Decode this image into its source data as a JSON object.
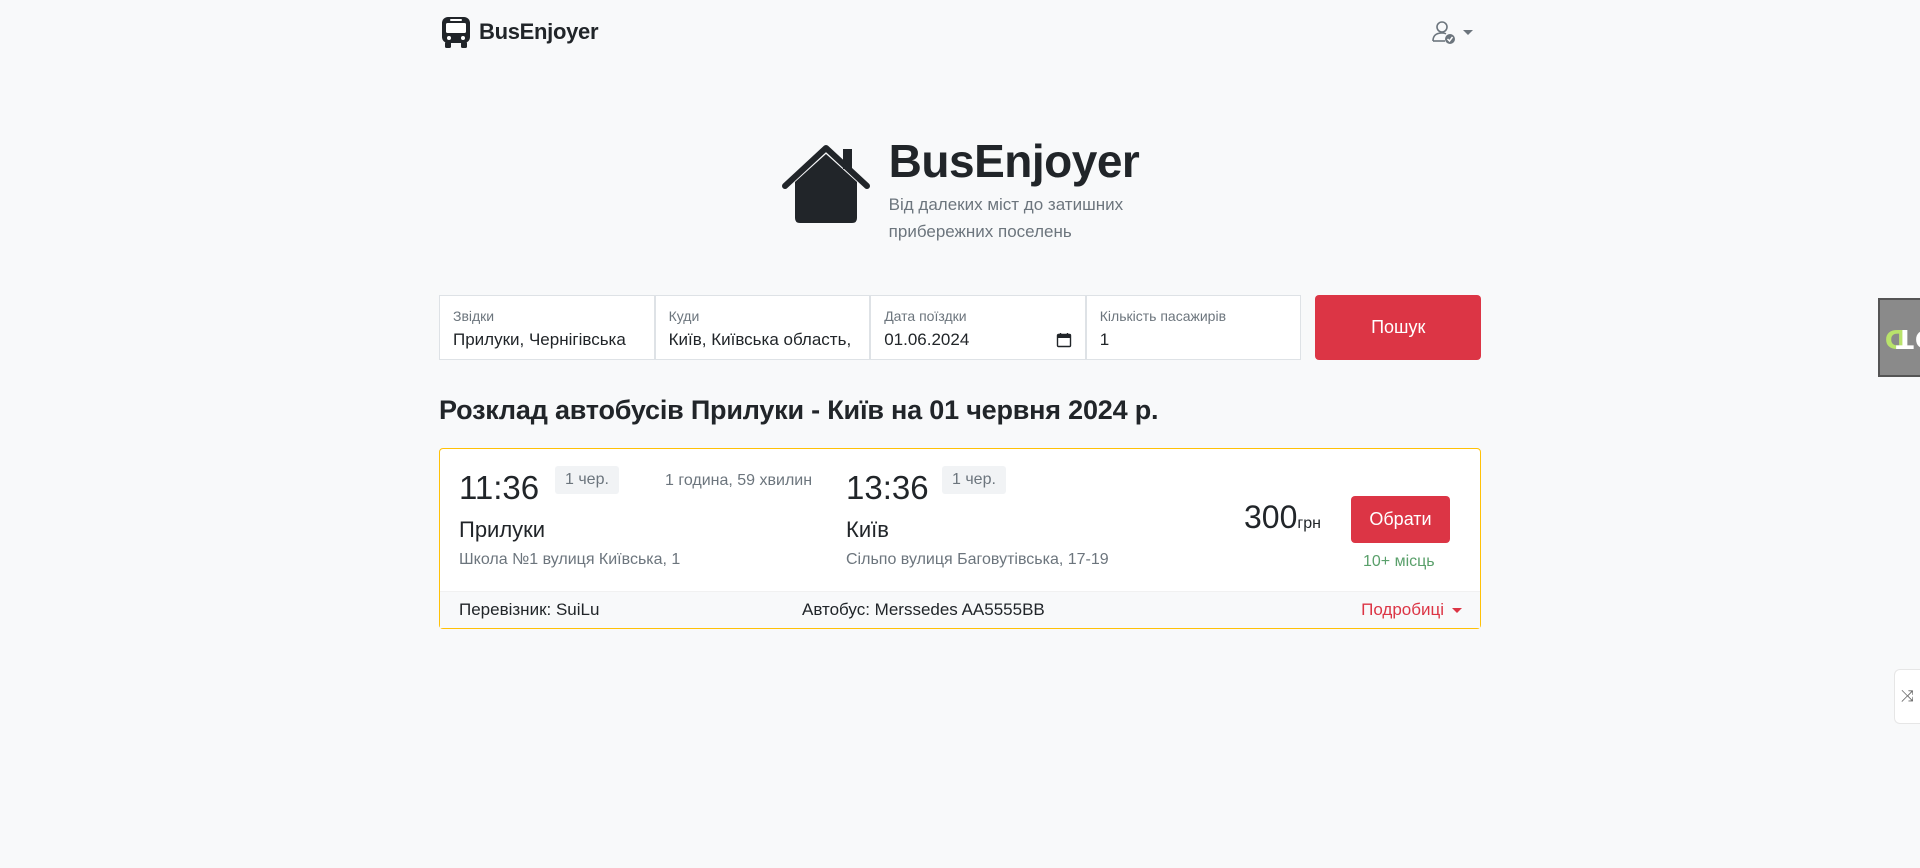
{
  "header": {
    "brand": "BusEnjoyer"
  },
  "hero": {
    "title": "BusEnjoyer",
    "subtitle_line1": "Від далеких міст до затишних",
    "subtitle_line2": "прибережних поселень"
  },
  "search": {
    "from_label": "Звідки",
    "from_value": "Прилуки, Чернігівська",
    "to_label": "Куди",
    "to_value": "Київ, Київська область,",
    "date_label": "Дата поїздки",
    "date_value": "01.06.2024",
    "passengers_label": "Кількість пасажирів",
    "passengers_value": "1",
    "button": "Пошук"
  },
  "results": {
    "title": "Розклад автобусів Прилуки - Київ на 01 червня 2024 р."
  },
  "trip": {
    "depart_time": "11:36",
    "depart_date": "1 чер.",
    "duration": "1 година, 59 хвилин",
    "arrive_time": "13:36",
    "arrive_date": "1 чер.",
    "from_city": "Прилуки",
    "from_stop": "Школа №1 вулиця Київська, 1",
    "to_city": "Київ",
    "to_stop": "Сільпо вулиця Баговутівська, 17-19",
    "price": "300",
    "currency": "грн",
    "choose_button": "Обрати",
    "seats": "10+ місць",
    "carrier": "Перевізник: SuiLu",
    "bus": "Автобус: Merssedes AA5555BB",
    "details": "Подробиці"
  },
  "widgets": {
    "ddt_label_1": "D",
    "ddt_label_2": "DT",
    "side_tab_icon": "⤨"
  }
}
